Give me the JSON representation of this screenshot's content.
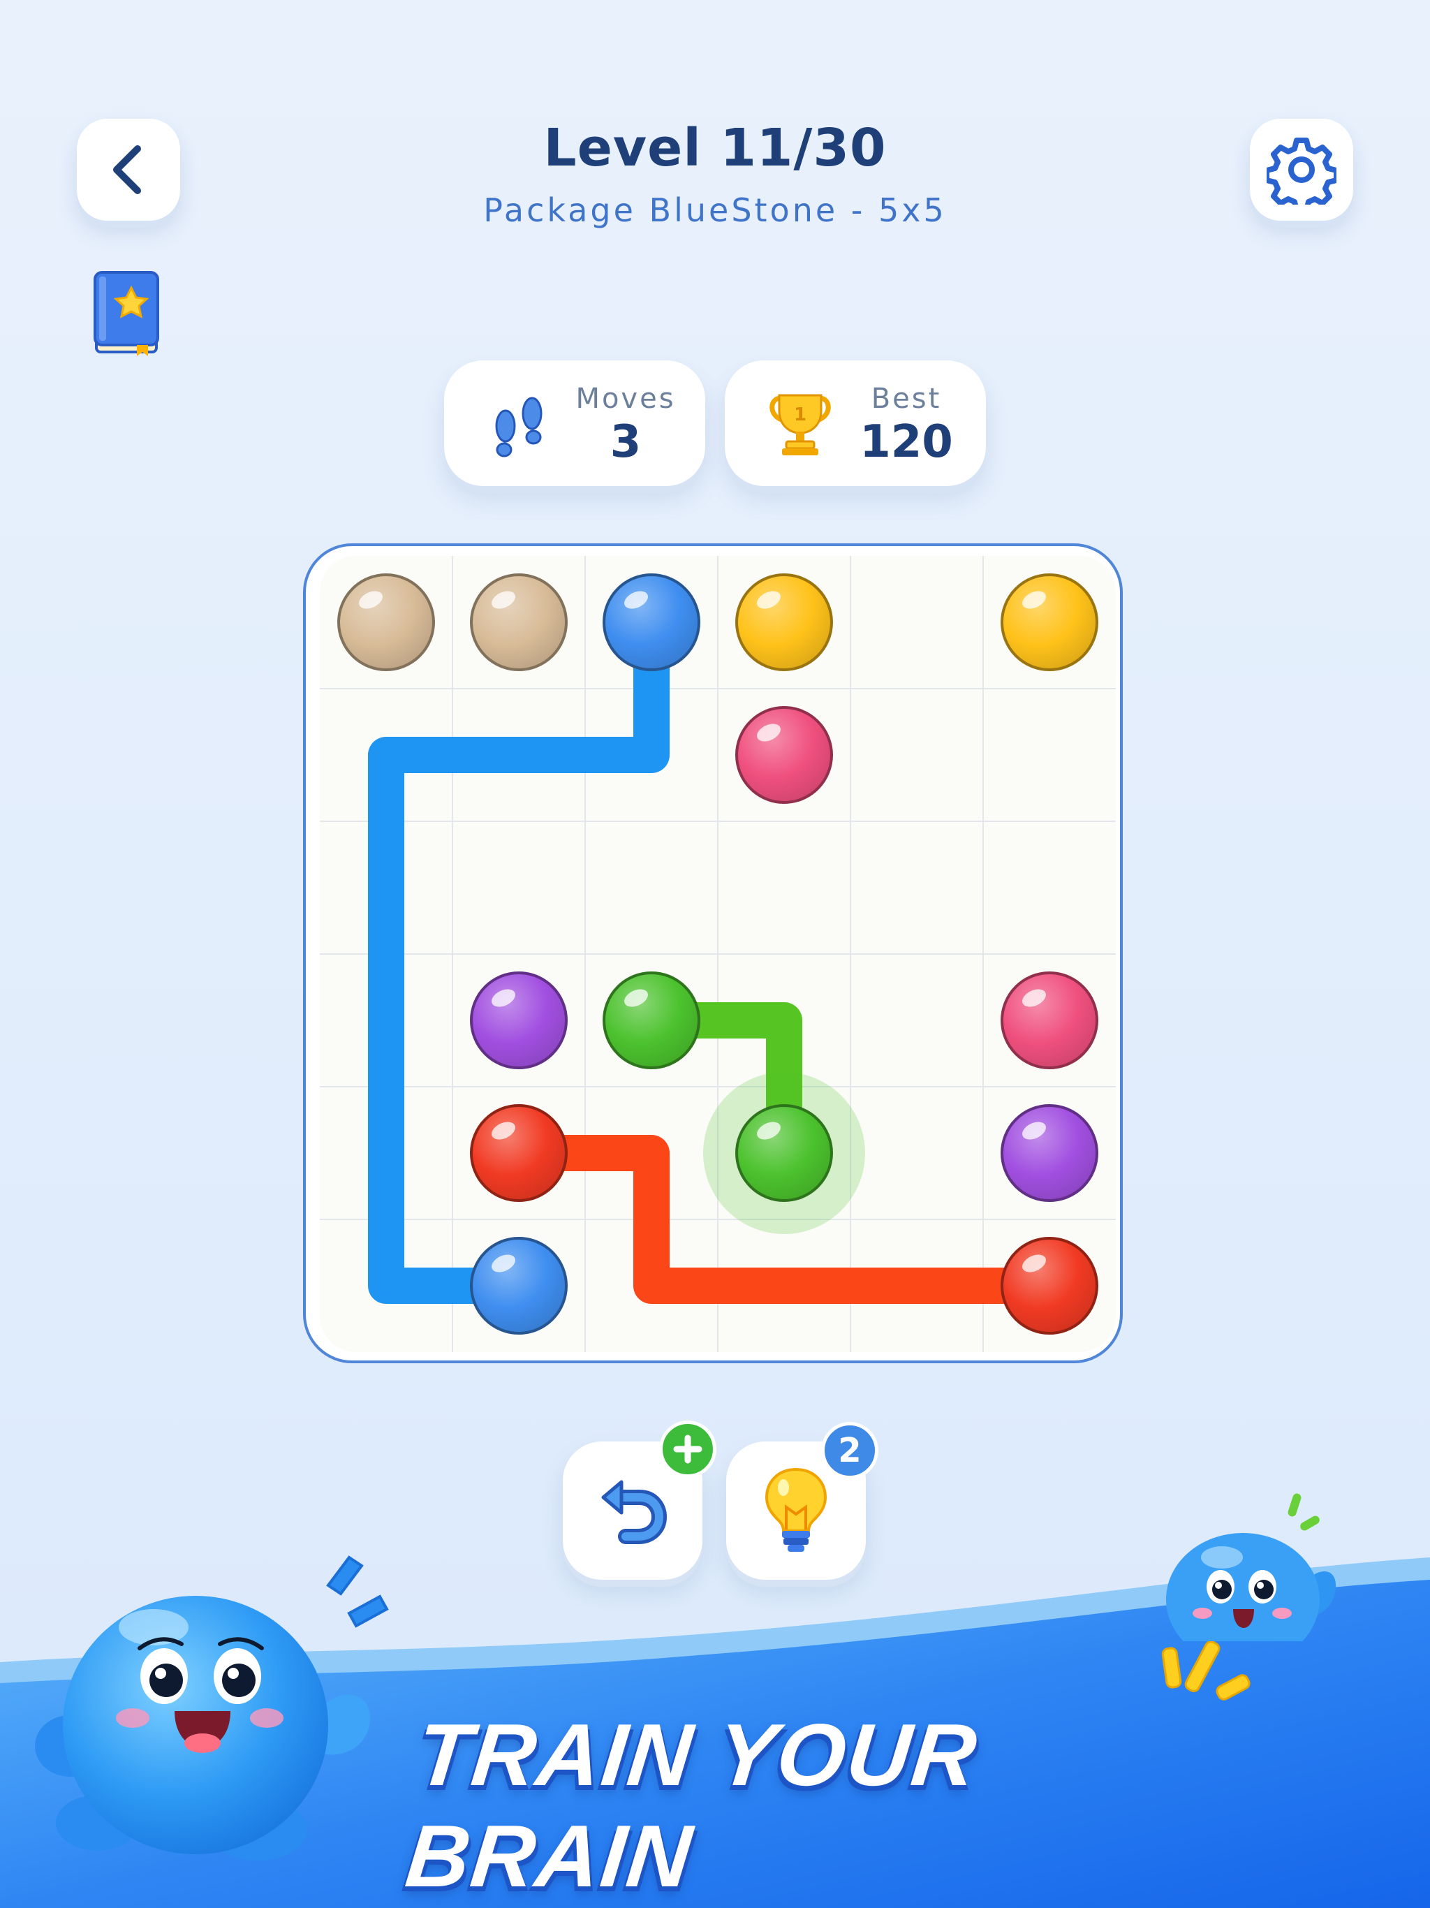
{
  "header": {
    "title": "Level 11/30",
    "subtitle": "Package BlueStone - 5x5"
  },
  "stats": {
    "moves": {
      "label": "Moves",
      "value": "3",
      "icon": "footprints-icon"
    },
    "best": {
      "label": "Best",
      "value": "120",
      "icon": "trophy-icon"
    }
  },
  "board": {
    "rows": 6,
    "cols": 6,
    "dots": [
      {
        "color": "tan",
        "row": 0,
        "col": 0
      },
      {
        "color": "tan",
        "row": 0,
        "col": 1
      },
      {
        "color": "blue",
        "row": 0,
        "col": 2
      },
      {
        "color": "yellow",
        "row": 0,
        "col": 3
      },
      {
        "color": "yellow",
        "row": 0,
        "col": 5
      },
      {
        "color": "pink",
        "row": 1,
        "col": 3
      },
      {
        "color": "purple",
        "row": 3,
        "col": 1
      },
      {
        "color": "green",
        "row": 3,
        "col": 2
      },
      {
        "color": "pink",
        "row": 3,
        "col": 5
      },
      {
        "color": "red",
        "row": 4,
        "col": 1
      },
      {
        "color": "green",
        "row": 4,
        "col": 3
      },
      {
        "color": "purple",
        "row": 4,
        "col": 5
      },
      {
        "color": "blue",
        "row": 5,
        "col": 1
      },
      {
        "color": "red",
        "row": 5,
        "col": 5
      }
    ],
    "paths": [
      {
        "color": "blue",
        "cells": [
          [
            0,
            2
          ],
          [
            1,
            2
          ],
          [
            1,
            1
          ],
          [
            1,
            0
          ],
          [
            2,
            0
          ],
          [
            3,
            0
          ],
          [
            4,
            0
          ],
          [
            5,
            0
          ],
          [
            5,
            1
          ]
        ]
      },
      {
        "color": "green",
        "cells": [
          [
            3,
            2
          ],
          [
            3,
            3
          ],
          [
            4,
            3
          ]
        ]
      },
      {
        "color": "red",
        "cells": [
          [
            4,
            1
          ],
          [
            4,
            2
          ],
          [
            5,
            2
          ],
          [
            5,
            3
          ],
          [
            5,
            4
          ],
          [
            5,
            5
          ]
        ]
      }
    ],
    "active_cell": [
      4,
      3
    ],
    "colors": {
      "tan": "#d8bc98",
      "blue": "#3f8ef0",
      "yellow": "#ffc21a",
      "pink": "#f0507e",
      "purple": "#a14fe0",
      "green": "#4cc22e",
      "red": "#f13a23",
      "path_blue": "#1f95f3",
      "path_green": "#56c423",
      "path_red": "#fb4618"
    }
  },
  "tools": {
    "undo": {
      "icon": "undo-arrow-icon",
      "badge_icon": "plus-icon"
    },
    "hint": {
      "icon": "lightbulb-icon",
      "badge": "2"
    }
  },
  "banner": {
    "text": "TRAIN YOUR BRAIN"
  },
  "accent": "#1e3f78"
}
